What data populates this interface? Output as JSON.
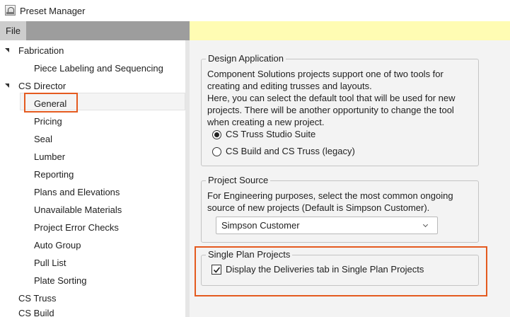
{
  "window": {
    "title": "Preset Manager",
    "icon": "app-icon"
  },
  "menu": {
    "file_label": "File"
  },
  "tree": {
    "fabrication": "Fabrication",
    "piece_labeling": "Piece Labeling and Sequencing",
    "cs_director": "CS Director",
    "general": "General",
    "pricing": "Pricing",
    "seal": "Seal",
    "lumber": "Lumber",
    "reporting": "Reporting",
    "plans_elevations": "Plans and Elevations",
    "unavailable_materials": "Unavailable Materials",
    "project_error_checks": "Project Error Checks",
    "auto_group": "Auto Group",
    "pull_list": "Pull List",
    "plate_sorting": "Plate Sorting",
    "cs_truss": "CS Truss",
    "cs_build": "CS Build",
    "selected": "General"
  },
  "design_application": {
    "legend": "Design Application",
    "line1": "Component Solutions projects support one of two tools for",
    "line2": "creating and editing trusses and layouts.",
    "line3": "Here, you can select the default tool that will be used for new",
    "line4": "projects. There will be another opportunity to change the tool",
    "line5": "when creating a new project.",
    "option1": "CS Truss Studio Suite",
    "option2": "CS Build and CS Truss (legacy)",
    "selected_option": "CS Truss Studio Suite"
  },
  "project_source": {
    "legend": "Project Source",
    "line1": "For Engineering purposes, select the most common ongoing",
    "line2": "source of new projects (Default is Simpson Customer).",
    "dropdown_value": "Simpson Customer"
  },
  "single_plan": {
    "legend": "Single Plan Projects",
    "checkbox_label": "Display the Deliveries tab in Single Plan Projects",
    "checked": true
  },
  "colors": {
    "menubar_accent": "#fffcb3",
    "highlight": "#e45a1f",
    "menubar": "#9d9d9d"
  }
}
